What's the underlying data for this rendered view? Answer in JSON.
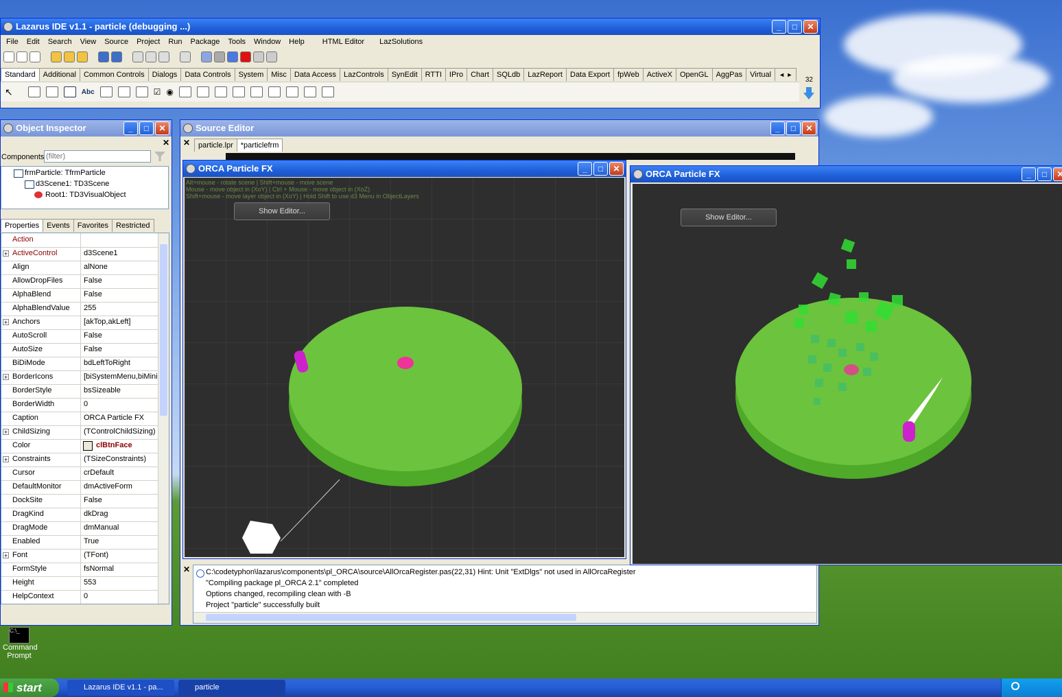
{
  "ide": {
    "title": "Lazarus IDE v1.1 - particle (debugging ...)",
    "menu": [
      "File",
      "Edit",
      "Search",
      "View",
      "Source",
      "Project",
      "Run",
      "Package",
      "Tools",
      "Window",
      "Help",
      "HTML Editor",
      "LazSolutions"
    ],
    "palette_tabs": [
      "Standard",
      "Additional",
      "Common Controls",
      "Dialogs",
      "Data Controls",
      "System",
      "Misc",
      "Data Access",
      "LazControls",
      "SynEdit",
      "RTTI",
      "IPro",
      "Chart",
      "SQLdb",
      "LazReport",
      "Data Export",
      "fpWeb",
      "ActiveX",
      "OpenGL",
      "AggPas",
      "Virtual"
    ],
    "palette_size": "32"
  },
  "inspector": {
    "title": "Object Inspector",
    "components_label": "Components",
    "filter_placeholder": "(filter)",
    "tree": [
      "frmParticle: TfrmParticle",
      "d3Scene1: TD3Scene",
      "Root1: TD3VisualObject"
    ],
    "tabs": [
      "Properties",
      "Events",
      "Favorites",
      "Restricted"
    ],
    "properties": [
      {
        "name": "Action",
        "value": ""
      },
      {
        "name": "ActiveControl",
        "value": "d3Scene1"
      },
      {
        "name": "Align",
        "value": "alNone"
      },
      {
        "name": "AllowDropFiles",
        "value": "False"
      },
      {
        "name": "AlphaBlend",
        "value": "False"
      },
      {
        "name": "AlphaBlendValue",
        "value": "255"
      },
      {
        "name": "Anchors",
        "value": "[akTop,akLeft]"
      },
      {
        "name": "AutoScroll",
        "value": "False"
      },
      {
        "name": "AutoSize",
        "value": "False"
      },
      {
        "name": "BiDiMode",
        "value": "bdLeftToRight"
      },
      {
        "name": "BorderIcons",
        "value": "[biSystemMenu,biMinim"
      },
      {
        "name": "BorderStyle",
        "value": "bsSizeable"
      },
      {
        "name": "BorderWidth",
        "value": "0"
      },
      {
        "name": "Caption",
        "value": "ORCA Particle FX"
      },
      {
        "name": "ChildSizing",
        "value": "(TControlChildSizing)"
      },
      {
        "name": "Color",
        "value": "clBtnFace"
      },
      {
        "name": "Constraints",
        "value": "(TSizeConstraints)"
      },
      {
        "name": "Cursor",
        "value": "crDefault"
      },
      {
        "name": "DefaultMonitor",
        "value": "dmActiveForm"
      },
      {
        "name": "DockSite",
        "value": "False"
      },
      {
        "name": "DragKind",
        "value": "dkDrag"
      },
      {
        "name": "DragMode",
        "value": "dmManual"
      },
      {
        "name": "Enabled",
        "value": "True"
      },
      {
        "name": "Font",
        "value": "(TFont)"
      },
      {
        "name": "FormStyle",
        "value": "fsNormal"
      },
      {
        "name": "Height",
        "value": "553"
      },
      {
        "name": "HelpContext",
        "value": "0"
      }
    ]
  },
  "source_editor": {
    "title": "Source Editor",
    "tabs": [
      "particle.lpr",
      "*particlefrm"
    ]
  },
  "orca1": {
    "title": "ORCA Particle FX",
    "hint1": "Alt+mouse - rotate scene | Shift+mouse - move scene",
    "hint2": "Mouse - move object in (XoY) | Ctrl + Mouse - move object in (XoZ)",
    "hint3": "Shift+mouse - move layer object in (XoY) | Hold Shift to use d3 Menu in ObjectLayers",
    "button": "Show Editor..."
  },
  "orca2": {
    "title": "ORCA Particle FX",
    "button": "Show Editor..."
  },
  "messages": {
    "lines": [
      "C:\\codetyphon\\lazarus\\components\\pl_ORCA\\source\\AllOrcaRegister.pas(22,31) Hint: Unit \"ExtDlgs\" not used in AllOrcaRegister",
      "\"Compiling package pl_ORCA 2.1\" completed",
      "Options changed, recompiling clean with -B",
      "Project \"particle\" successfully built"
    ]
  },
  "desktop": {
    "icon_label_1": "Command",
    "icon_label_2": "Prompt"
  },
  "taskbar": {
    "start": "start",
    "tasks": [
      "Lazarus IDE v1.1 - pa...",
      "particle"
    ]
  },
  "colors": {
    "xp_blue": "#245dd6",
    "scene_bg": "#2e2e2e",
    "disk_green": "#6cc33e",
    "particle_green": "#33dd33",
    "magenta": "#cc22cc",
    "prop_red": "#8b0000"
  }
}
